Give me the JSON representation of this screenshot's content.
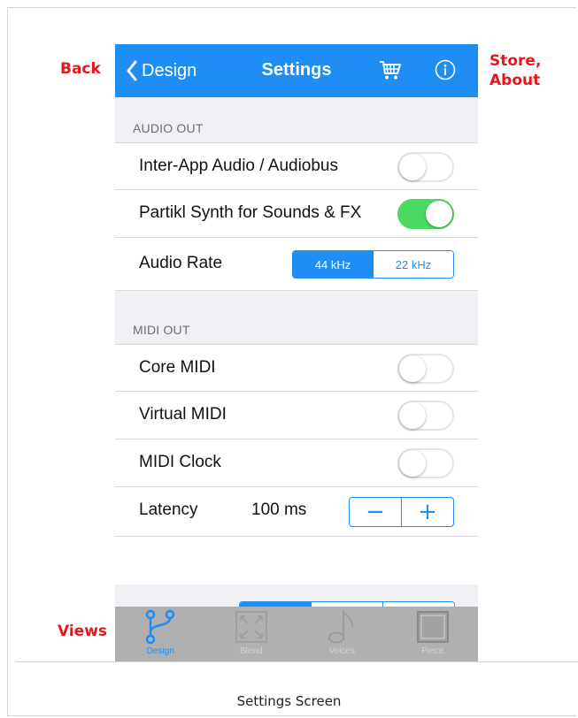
{
  "annotations": {
    "back": "Back",
    "store_about": "Store,\nAbout",
    "views": "Views"
  },
  "caption": "Settings Screen",
  "navbar": {
    "back_label": "Design",
    "title": "Settings",
    "icons": [
      "chevron-left-icon",
      "cart-icon",
      "info-icon"
    ]
  },
  "sections": {
    "audio_out": {
      "header": "AUDIO OUT",
      "inter_app": {
        "label": "Inter-App Audio / Audiobus",
        "on": false
      },
      "partikl": {
        "label": "Partikl Synth for Sounds & FX",
        "on": true
      },
      "audio_rate": {
        "label": "Audio Rate",
        "options": [
          "44 kHz",
          "22 kHz"
        ],
        "selected": "44 kHz"
      }
    },
    "midi_out": {
      "header": "MIDI OUT",
      "core_midi": {
        "label": "Core MIDI",
        "on": false
      },
      "virtual_midi": {
        "label": "Virtual MIDI",
        "on": false
      },
      "midi_clock": {
        "label": "MIDI Clock",
        "on": false
      },
      "latency": {
        "label": "Latency",
        "value": "100 ms",
        "decrement": "−",
        "increment": "+"
      }
    }
  },
  "tabbar": {
    "tabs": [
      {
        "label": "Design",
        "icon": "branch-icon",
        "active": true
      },
      {
        "label": "Blend",
        "icon": "expand-icon",
        "active": false
      },
      {
        "label": "Voices",
        "icon": "music-note-icon",
        "active": false
      },
      {
        "label": "Piece",
        "icon": "square-icon",
        "active": false
      }
    ]
  },
  "colors": {
    "accent": "#1e8ef5",
    "toggle_on": "#4cd964",
    "annotation": "#e8141e",
    "tabbar": "#b0b0b2",
    "background": "#efeff4"
  }
}
